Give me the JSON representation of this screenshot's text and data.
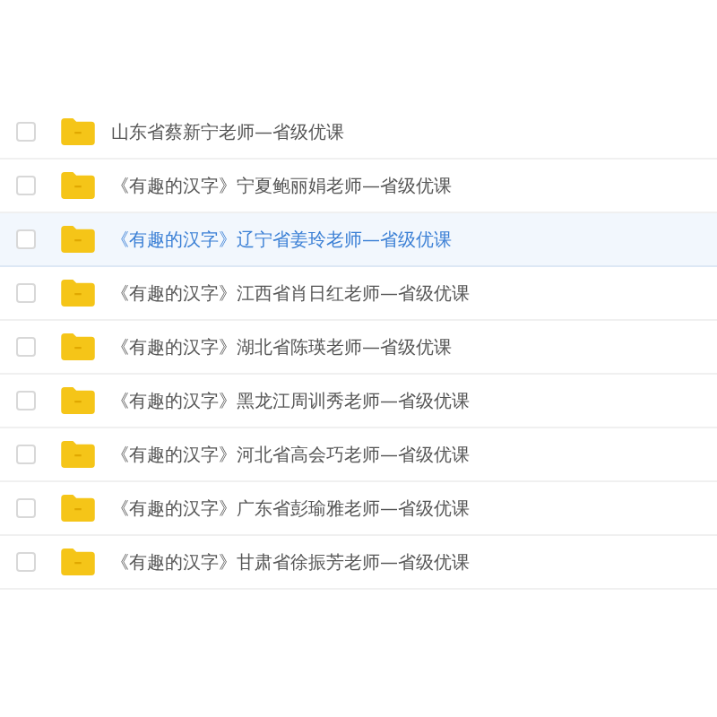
{
  "files": [
    {
      "name": "山东省蔡新宁老师—省级优课",
      "selected": false
    },
    {
      "name": "《有趣的汉字》宁夏鲍丽娟老师—省级优课",
      "selected": false
    },
    {
      "name": "《有趣的汉字》辽宁省姜玲老师—省级优课",
      "selected": true
    },
    {
      "name": "《有趣的汉字》江西省肖日红老师—省级优课",
      "selected": false
    },
    {
      "name": "《有趣的汉字》湖北省陈瑛老师—省级优课",
      "selected": false
    },
    {
      "name": "《有趣的汉字》黑龙江周训秀老师—省级优课",
      "selected": false
    },
    {
      "name": "《有趣的汉字》河北省高会巧老师—省级优课",
      "selected": false
    },
    {
      "name": "《有趣的汉字》广东省彭瑜雅老师—省级优课",
      "selected": false
    },
    {
      "name": "《有趣的汉字》甘肃省徐振芳老师—省级优课",
      "selected": false
    }
  ]
}
